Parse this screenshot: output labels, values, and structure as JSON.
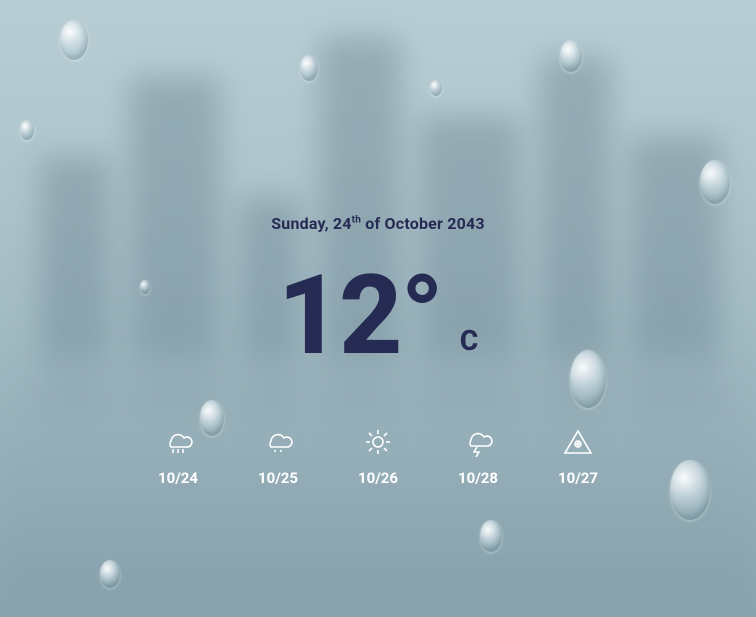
{
  "date": {
    "prefix": "Sunday, 24",
    "ordinal": "th",
    "suffix": " of October 2043"
  },
  "temperature": {
    "value": "12°",
    "unit": "C"
  },
  "forecast": [
    {
      "date": "10/24",
      "icon": "rain"
    },
    {
      "date": "10/25",
      "icon": "drizzle"
    },
    {
      "date": "10/26",
      "icon": "sunny"
    },
    {
      "date": "10/28",
      "icon": "thunder"
    },
    {
      "date": "10/27",
      "icon": "warning"
    }
  ]
}
